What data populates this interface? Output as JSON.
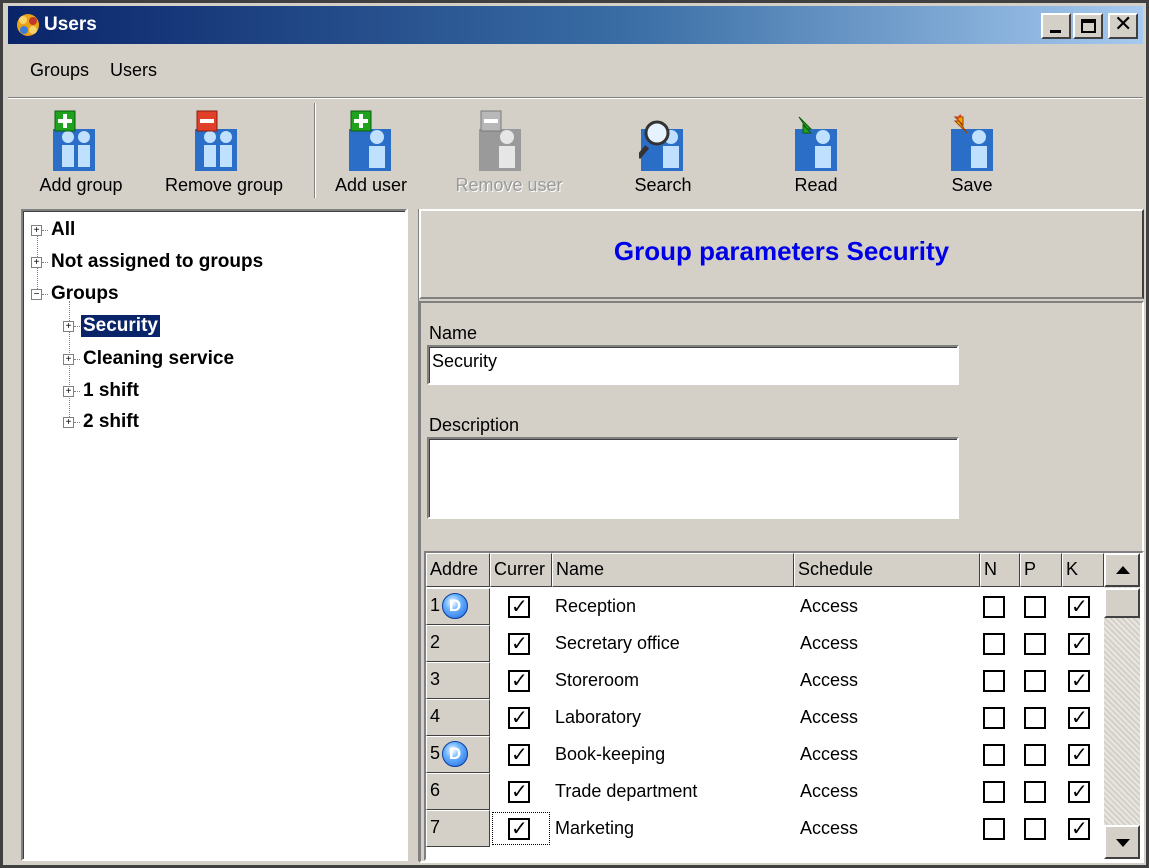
{
  "window": {
    "title": "Users"
  },
  "menu": [
    "Groups",
    "Users"
  ],
  "toolbar": {
    "add_group": "Add group",
    "remove_group": "Remove group",
    "add_user": "Add user",
    "remove_user": "Remove user",
    "search": "Search",
    "read": "Read",
    "save": "Save"
  },
  "tree": {
    "all": "All",
    "not_assigned": "Not assigned to groups",
    "groups": "Groups",
    "children": [
      "Security",
      "Cleaning service",
      "1 shift",
      "2 shift"
    ],
    "selected": "Security"
  },
  "panel": {
    "title": "Group parameters Security",
    "name_label": "Name",
    "name_value": "Security",
    "description_label": "Description",
    "description_value": ""
  },
  "grid": {
    "headers": [
      "Addre",
      "Currer",
      "Name",
      "Schedule",
      "N",
      "P",
      "K"
    ],
    "rows": [
      {
        "address": "1",
        "badge": "D",
        "current": true,
        "name": "Reception",
        "schedule": "Access",
        "n": false,
        "p": false,
        "k": true
      },
      {
        "address": "2",
        "badge": "",
        "current": true,
        "name": "Secretary office",
        "schedule": "Access",
        "n": false,
        "p": false,
        "k": true
      },
      {
        "address": "3",
        "badge": "",
        "current": true,
        "name": "Storeroom",
        "schedule": "Access",
        "n": false,
        "p": false,
        "k": true
      },
      {
        "address": "4",
        "badge": "",
        "current": true,
        "name": "Laboratory",
        "schedule": "Access",
        "n": false,
        "p": false,
        "k": true
      },
      {
        "address": "5",
        "badge": "D",
        "current": true,
        "name": "Book-keeping",
        "schedule": "Access",
        "n": false,
        "p": false,
        "k": true
      },
      {
        "address": "6",
        "badge": "",
        "current": true,
        "name": "Trade department",
        "schedule": "Access",
        "n": false,
        "p": false,
        "k": true
      },
      {
        "address": "7",
        "badge": "",
        "current": true,
        "name": "Marketing",
        "schedule": "Access",
        "n": false,
        "p": false,
        "k": true
      }
    ]
  },
  "colors": {
    "title_gradient_start": "#0a246a",
    "panel_title": "#0000e6",
    "selection": "#0a246a",
    "add_badge": "#1fa31f",
    "remove_badge": "#e0402a"
  },
  "icons": {
    "plus": "+",
    "minus": "−",
    "check": "✓"
  }
}
